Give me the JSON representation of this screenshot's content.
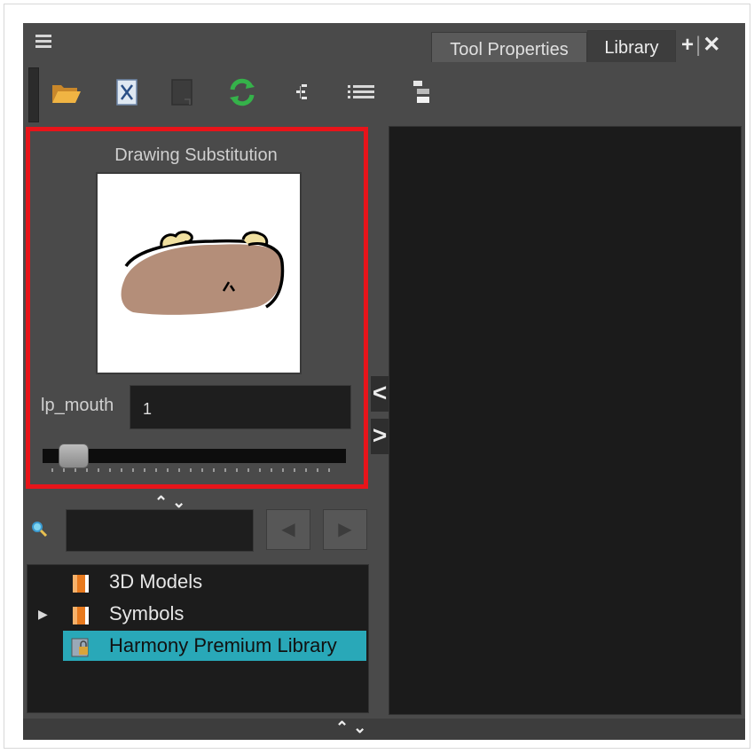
{
  "tabs": [
    {
      "label": "Tool Properties"
    },
    {
      "label": "Library"
    }
  ],
  "tab_actions": {
    "add": "+",
    "separator": "|",
    "close": "✕"
  },
  "toolbar": [
    {
      "icon": "open-folder-icon"
    },
    {
      "icon": "cut-drawing-icon"
    },
    {
      "icon": "blank-page-icon"
    },
    {
      "icon": "refresh-icon"
    },
    {
      "icon": "tree-view-icon"
    },
    {
      "icon": "list-view-icon"
    },
    {
      "icon": "split-view-icon"
    }
  ],
  "drawing_substitution": {
    "title": "Drawing Substitution",
    "layer_label": "lp_mouth",
    "value": "1",
    "slider_value": 1
  },
  "collapse": {
    "up": "⌃",
    "down": "⌄"
  },
  "side_toggles": {
    "left": "<",
    "right": ">"
  },
  "search": {
    "placeholder": "",
    "prev": "◀",
    "next": "▶"
  },
  "library_tree": [
    {
      "label": "3D Models",
      "expandable": false,
      "selected": false
    },
    {
      "label": "Symbols",
      "expandable": true,
      "selected": false
    },
    {
      "label": "Harmony Premium Library",
      "expandable": false,
      "selected": true
    }
  ],
  "colors": {
    "highlight": "#e8141a",
    "selection": "#29a8b8",
    "panel": "#4a4a4a"
  }
}
